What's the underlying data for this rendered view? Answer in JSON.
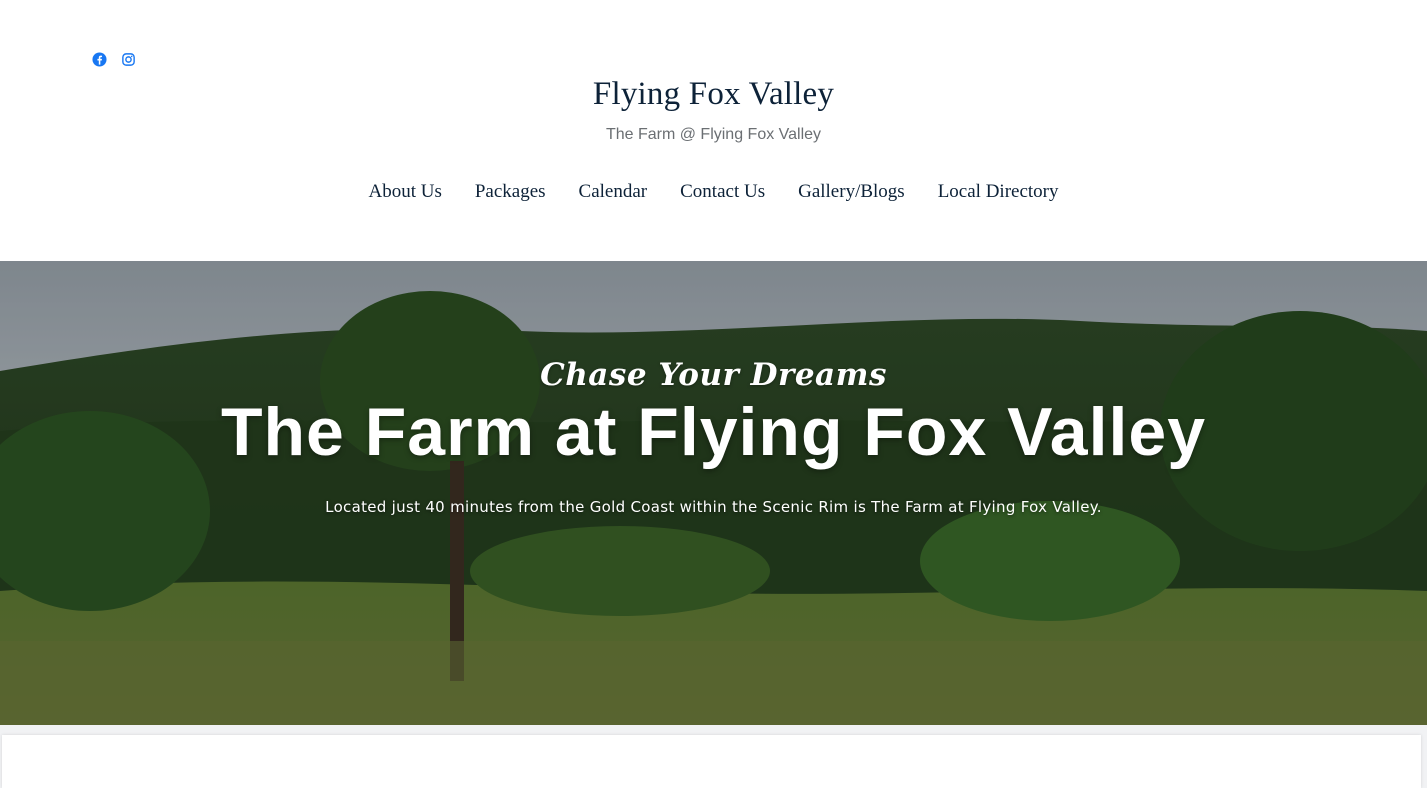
{
  "header": {
    "social_icons": [
      "facebook-icon",
      "instagram-icon"
    ],
    "social_color": "#1877f2",
    "site_title": "Flying Fox Valley",
    "tagline": "The Farm @ Flying Fox Valley"
  },
  "nav": {
    "items": [
      {
        "label": "About Us"
      },
      {
        "label": "Packages"
      },
      {
        "label": "Calendar"
      },
      {
        "label": "Contact Us"
      },
      {
        "label": "Gallery/Blogs"
      },
      {
        "label": "Local Directory"
      }
    ]
  },
  "hero": {
    "kicker": "Chase Your Dreams",
    "title": "The Farm at Flying Fox Valley",
    "subtitle": "Located just 40 minutes from the Gold Coast within the Scenic Rim is The Farm at Flying Fox Valley."
  }
}
